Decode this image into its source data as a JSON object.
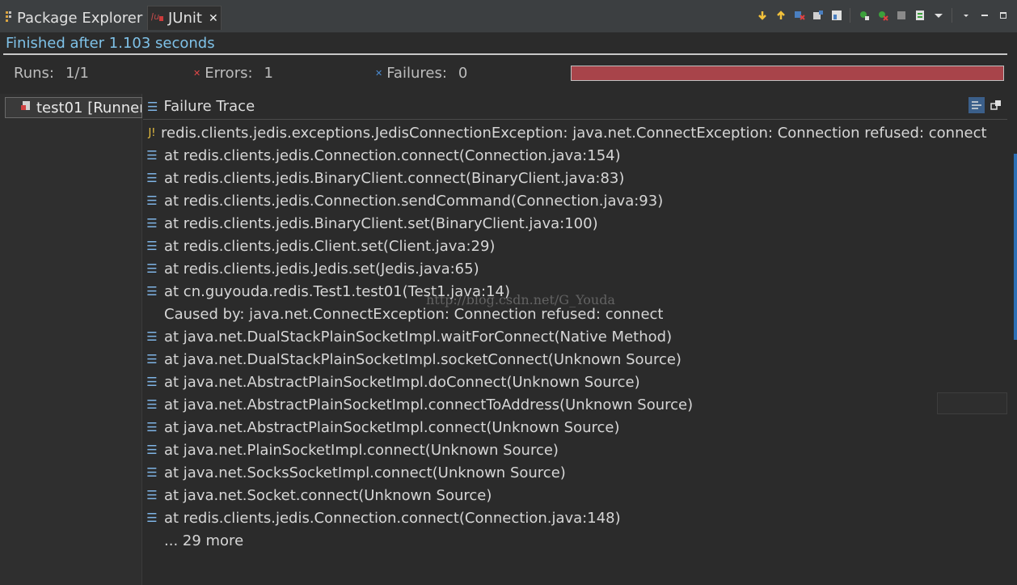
{
  "tabs": [
    {
      "label": "Package Explorer",
      "icon": "package-explorer-icon"
    },
    {
      "label": "JUnit",
      "icon": "junit-icon",
      "close": "✕"
    }
  ],
  "status": {
    "text": "Finished after 1.103 seconds"
  },
  "counters": {
    "runs_label": "Runs:",
    "runs_value": "1/1",
    "errors_label": "Errors:",
    "errors_value": "1",
    "failures_label": "Failures:",
    "failures_value": "0",
    "progress_fraction": 1.0,
    "progress_color": "#a8444a"
  },
  "tree": {
    "item_label": "test01 [Runner"
  },
  "trace": {
    "header": "Failure Trace",
    "lines": [
      {
        "icon": "exception-icon",
        "text": "redis.clients.jedis.exceptions.JedisConnectionException: java.net.ConnectException: Connection refused: connect"
      },
      {
        "icon": "stack-frame-icon",
        "text": "at redis.clients.jedis.Connection.connect(Connection.java:154)"
      },
      {
        "icon": "stack-frame-icon",
        "text": "at redis.clients.jedis.BinaryClient.connect(BinaryClient.java:83)"
      },
      {
        "icon": "stack-frame-icon",
        "text": "at redis.clients.jedis.Connection.sendCommand(Connection.java:93)"
      },
      {
        "icon": "stack-frame-icon",
        "text": "at redis.clients.jedis.BinaryClient.set(BinaryClient.java:100)"
      },
      {
        "icon": "stack-frame-icon",
        "text": "at redis.clients.jedis.Client.set(Client.java:29)"
      },
      {
        "icon": "stack-frame-icon",
        "text": "at redis.clients.jedis.Jedis.set(Jedis.java:65)"
      },
      {
        "icon": "stack-frame-icon",
        "text": "at cn.guyouda.redis.Test1.test01(Test1.java:14)"
      },
      {
        "icon": "none",
        "text": "Caused by: java.net.ConnectException: Connection refused: connect"
      },
      {
        "icon": "stack-frame-icon",
        "text": "at java.net.DualStackPlainSocketImpl.waitForConnect(Native Method)"
      },
      {
        "icon": "stack-frame-icon",
        "text": "at java.net.DualStackPlainSocketImpl.socketConnect(Unknown Source)"
      },
      {
        "icon": "stack-frame-icon",
        "text": "at java.net.AbstractPlainSocketImpl.doConnect(Unknown Source)"
      },
      {
        "icon": "stack-frame-icon",
        "text": "at java.net.AbstractPlainSocketImpl.connectToAddress(Unknown Source)"
      },
      {
        "icon": "stack-frame-icon",
        "text": "at java.net.AbstractPlainSocketImpl.connect(Unknown Source)"
      },
      {
        "icon": "stack-frame-icon",
        "text": "at java.net.PlainSocketImpl.connect(Unknown Source)"
      },
      {
        "icon": "stack-frame-icon",
        "text": "at java.net.SocksSocketImpl.connect(Unknown Source)"
      },
      {
        "icon": "stack-frame-icon",
        "text": "at java.net.Socket.connect(Unknown Source)"
      },
      {
        "icon": "stack-frame-icon",
        "text": "at redis.clients.jedis.Connection.connect(Connection.java:148)"
      },
      {
        "icon": "none",
        "text": "... 29 more"
      }
    ]
  },
  "watermark": "http://blog.csdn.net/G_Youda"
}
